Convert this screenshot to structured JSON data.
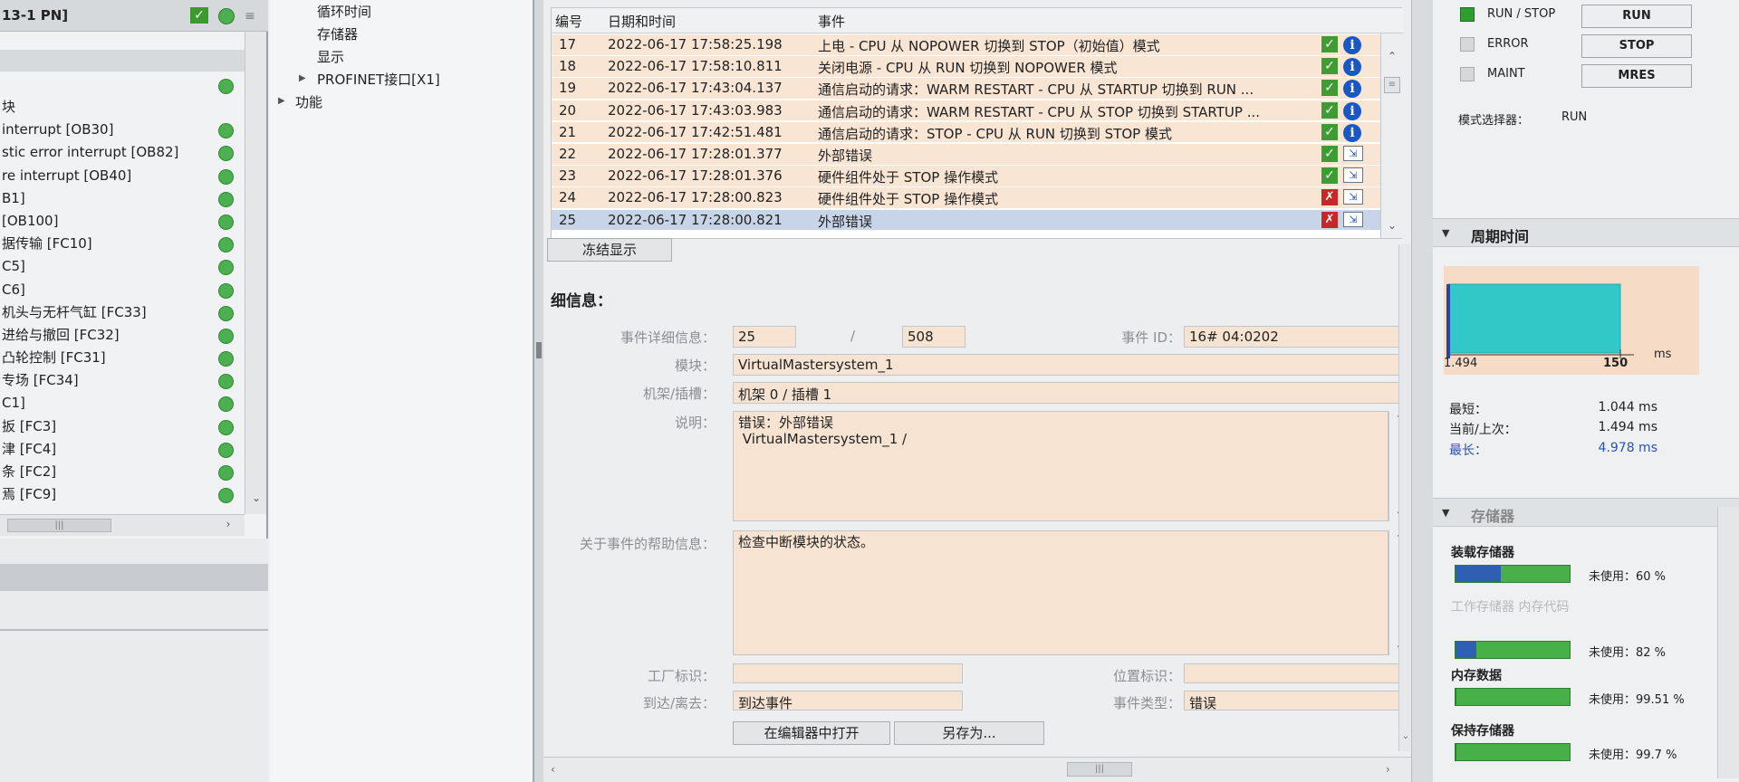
{
  "left": {
    "title": "13-1 PN]",
    "items": [
      {
        "text": "块",
        "x": 2
      },
      {
        "text": "interrupt [OB30]",
        "x": 2
      },
      {
        "text": "stic error interrupt [OB82]",
        "x": 2
      },
      {
        "text": "re interrupt [OB40]",
        "x": 2
      },
      {
        "text": "B1]",
        "x": 2
      },
      {
        "text": " [OB100]",
        "x": 2
      },
      {
        "text": "据传输 [FC10]",
        "x": 2
      },
      {
        "text": "C5]",
        "x": 2
      },
      {
        "text": "C6]",
        "x": 2
      },
      {
        "text": "机头与无杆气缸 [FC33]",
        "x": 2
      },
      {
        "text": "进给与撤回 [FC32]",
        "x": 2
      },
      {
        "text": "凸轮控制 [FC31]",
        "x": 2
      },
      {
        "text": "专场 [FC34]",
        "x": 2
      },
      {
        "text": "C1]",
        "x": 2
      },
      {
        "text": "扳 [FC3]",
        "x": 2
      },
      {
        "text": "津 [FC4]",
        "x": 2
      },
      {
        "text": "条 [FC2]",
        "x": 2
      },
      {
        "text": "焉 [FC9]",
        "x": 2
      }
    ],
    "scroll_thumb": "|||"
  },
  "tree": {
    "items": [
      "循环时间",
      "存储器",
      "显示",
      "PROFINET接口[X1]",
      "功能"
    ]
  },
  "diag": {
    "headers": {
      "id": "编号",
      "datetime": "日期和时间",
      "event": "事件"
    },
    "rows": [
      {
        "id": "17",
        "datetime": "2022-06-17 17:58:25.198",
        "event": "上电 - CPU 从 NOPOWER 切换到 STOP（初始值）模式",
        "status": "ok",
        "type": "info"
      },
      {
        "id": "18",
        "datetime": "2022-06-17 17:58:10.811",
        "event": "关闭电源 - CPU 从 RUN 切换到 NOPOWER 模式",
        "status": "ok",
        "type": "info"
      },
      {
        "id": "19",
        "datetime": "2022-06-17 17:43:04.137",
        "event": "通信启动的请求：WARM RESTART - CPU 从 STARTUP 切换到 RUN ...",
        "status": "ok",
        "type": "info"
      },
      {
        "id": "20",
        "datetime": "2022-06-17 17:43:03.983",
        "event": "通信启动的请求：WARM RESTART - CPU 从 STOP 切换到 STARTUP ...",
        "status": "ok",
        "type": "info"
      },
      {
        "id": "21",
        "datetime": "2022-06-17 17:42:51.481",
        "event": "通信启动的请求：STOP - CPU 从 RUN 切换到 STOP 模式",
        "status": "ok",
        "type": "info"
      },
      {
        "id": "22",
        "datetime": "2022-06-17 17:28:01.377",
        "event": "外部错误",
        "status": "ok",
        "type": "fwd"
      },
      {
        "id": "23",
        "datetime": "2022-06-17 17:28:01.376",
        "event": "硬件组件处于 STOP 操作模式",
        "status": "ok",
        "type": "fwd"
      },
      {
        "id": "24",
        "datetime": "2022-06-17 17:28:00.823",
        "event": "硬件组件处于 STOP 操作模式",
        "status": "err",
        "type": "fwd"
      },
      {
        "id": "25",
        "datetime": "2022-06-17 17:28:00.821",
        "event": "外部错误",
        "status": "err",
        "type": "fwd",
        "selected": true
      }
    ],
    "freeze_label": "冻结显示"
  },
  "detail": {
    "title": "细信息：",
    "event_detail_label": "事件详细信息：",
    "event_index": "25",
    "separator": "/",
    "event_total": "508",
    "event_id_label": "事件 ID：",
    "event_id": "16# 04:0202",
    "module_label": "模块：",
    "module": "VirtualMastersystem_1",
    "rack_label": "机架/插槽：",
    "rack": "机架 0 / 插槽 1",
    "desc_label": "说明：",
    "desc": "错误：外部错误\n VirtualMastersystem_1 /",
    "help_label": "关于事件的帮助信息：",
    "help": "检查中断模块的状态。",
    "plant_label": "工厂标识：",
    "plant": "",
    "location_label": "位置标识：",
    "location": "",
    "arrive_label": "到达/离去：",
    "arrive": "到达事件",
    "event_type_label": "事件类型：",
    "event_type": "错误",
    "open_editor": "在编辑器中打开",
    "save_as": "另存为..."
  },
  "cpu": {
    "leds": [
      "RUN / STOP",
      "ERROR",
      "MAINT"
    ],
    "buttons": [
      "RUN",
      "STOP",
      "MRES"
    ],
    "mode_label": "模式选择器：",
    "mode_value": "RUN"
  },
  "cycle": {
    "title": "周期时间",
    "axis_min": "1.494",
    "axis_max": "150",
    "unit": "ms",
    "shortest_label": "最短：",
    "shortest": "1.044 ms",
    "current_label": "当前/上次：",
    "current": "1.494 ms",
    "longest_label": "最长：",
    "longest": "4.978 ms"
  },
  "memory": {
    "title": "存储器",
    "items": [
      {
        "name": "装载存储器",
        "used_pct": 40,
        "free_label": "未使用：60 %"
      },
      {
        "name": "工作存储器 内存代码",
        "used_pct": 18,
        "free_label": "未使用：82 %"
      },
      {
        "name": "内存数据",
        "used_pct": 0.5,
        "free_label": "未使用：99.51 %"
      },
      {
        "name": "保持存储器",
        "used_pct": 0.3,
        "free_label": "未使用：99.7 %"
      }
    ]
  },
  "colors": {
    "row_bg": "#f8e5d4",
    "row_selected": "#c8d5e8",
    "ok_green": "#3e9c33",
    "error_red": "#c62828",
    "info_blue": "#1958c2",
    "cycle_bar": "#33c8c8"
  }
}
